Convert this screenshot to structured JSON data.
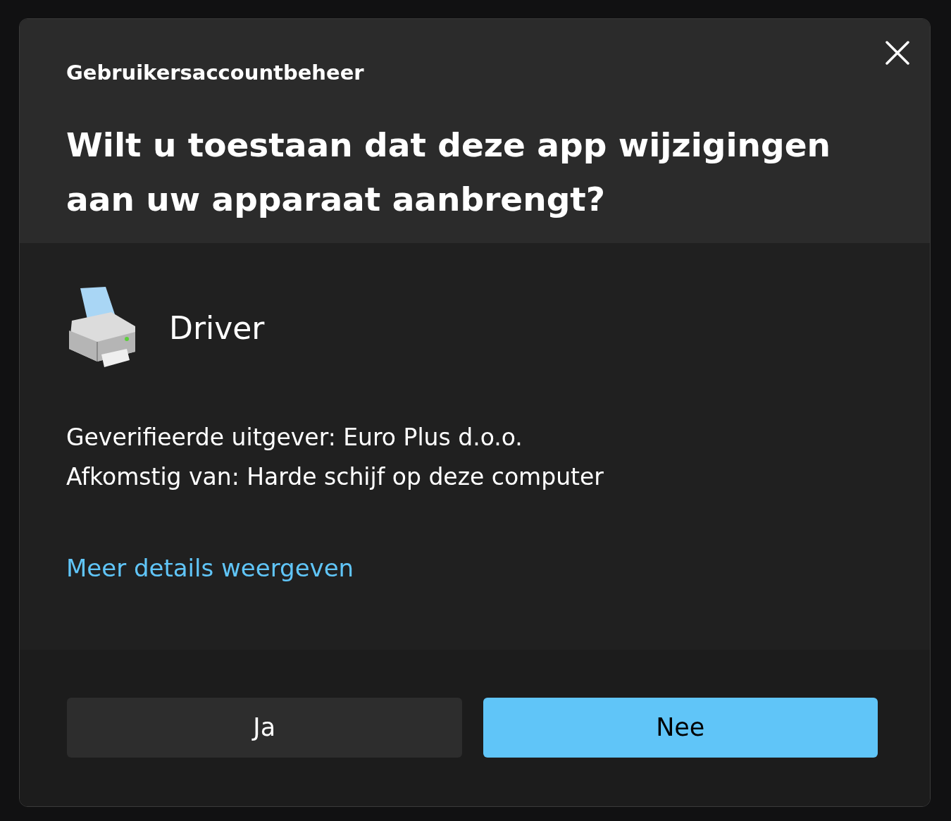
{
  "window": {
    "title": "Gebruikersaccountbeheer"
  },
  "question": "Wilt u toestaan dat deze app wijzigingen aan uw apparaat aanbrengt?",
  "app": {
    "name": "Driver"
  },
  "details": [
    "Geverifieerde uitgever: Euro Plus d.o.o.",
    "Afkomstig van: Harde schijf op deze computer"
  ],
  "link": "Meer details weergeven",
  "buttons": [
    {
      "label": "Ja",
      "kind": "secondary"
    },
    {
      "label": "Nee",
      "kind": "primary"
    }
  ]
}
